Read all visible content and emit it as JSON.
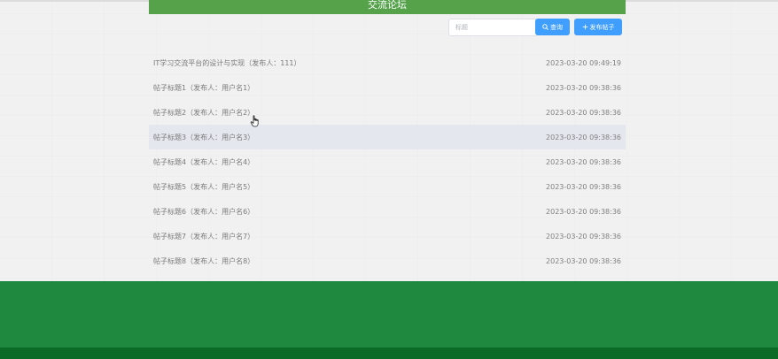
{
  "header": {
    "title": "交流论坛"
  },
  "search": {
    "placeholder": "标题",
    "value": ""
  },
  "toolbar": {
    "query_label": "查询",
    "post_label": "发布帖子"
  },
  "posts": [
    {
      "title": "IT学习交流平台的设计与实现（发布人：111）",
      "time": "2023-03-20 09:49:19"
    },
    {
      "title": "帖子标题1（发布人：用户名1）",
      "time": "2023-03-20 09:38:36"
    },
    {
      "title": "帖子标题2（发布人：用户名2）",
      "time": "2023-03-20 09:38:36"
    },
    {
      "title": "帖子标题3（发布人：用户名3）",
      "time": "2023-03-20 09:38:36"
    },
    {
      "title": "帖子标题4（发布人：用户名4）",
      "time": "2023-03-20 09:38:36"
    },
    {
      "title": "帖子标题5（发布人：用户名5）",
      "time": "2023-03-20 09:38:36"
    },
    {
      "title": "帖子标题6（发布人：用户名6）",
      "time": "2023-03-20 09:38:36"
    },
    {
      "title": "帖子标题7（发布人：用户名7）",
      "time": "2023-03-20 09:38:36"
    },
    {
      "title": "帖子标题8（发布人：用户名8）",
      "time": "2023-03-20 09:38:36"
    }
  ],
  "colors": {
    "title_bar": "#55a24b",
    "button": "#409eff",
    "footer": "#1f8a3f",
    "footer_bottom": "#0a6a26",
    "row_hover": "#e4e7ee"
  },
  "icons": {
    "query": "search-icon",
    "post": "plus-icon"
  }
}
